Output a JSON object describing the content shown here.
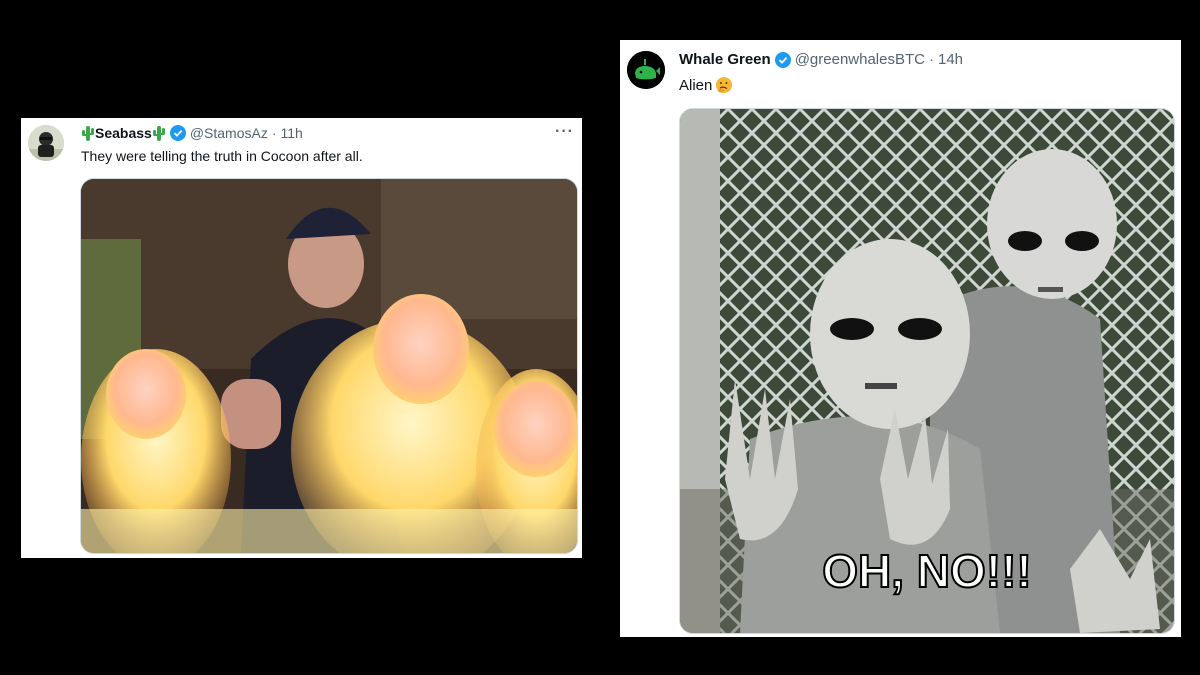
{
  "tweets": [
    {
      "display_name": "Seabass",
      "handle": "@StamosAz",
      "time": "11h",
      "text": "They were telling the truth in Cocoon after all.",
      "more_label": "···",
      "icons": [
        "cactus-emoji",
        "verified-badge",
        "more-icon"
      ]
    },
    {
      "display_name": "Whale Green",
      "handle": "@greenwhalesBTC",
      "time": "14h",
      "text": "Alien",
      "meme_caption": "OH, NO!!!",
      "icons": [
        "verified-badge",
        "thinking-face-emoji"
      ]
    }
  ],
  "colors": {
    "verified": "#1d9bf0",
    "text": "#0f1419",
    "meta": "#536471",
    "whale_green": "#2fb24a"
  }
}
